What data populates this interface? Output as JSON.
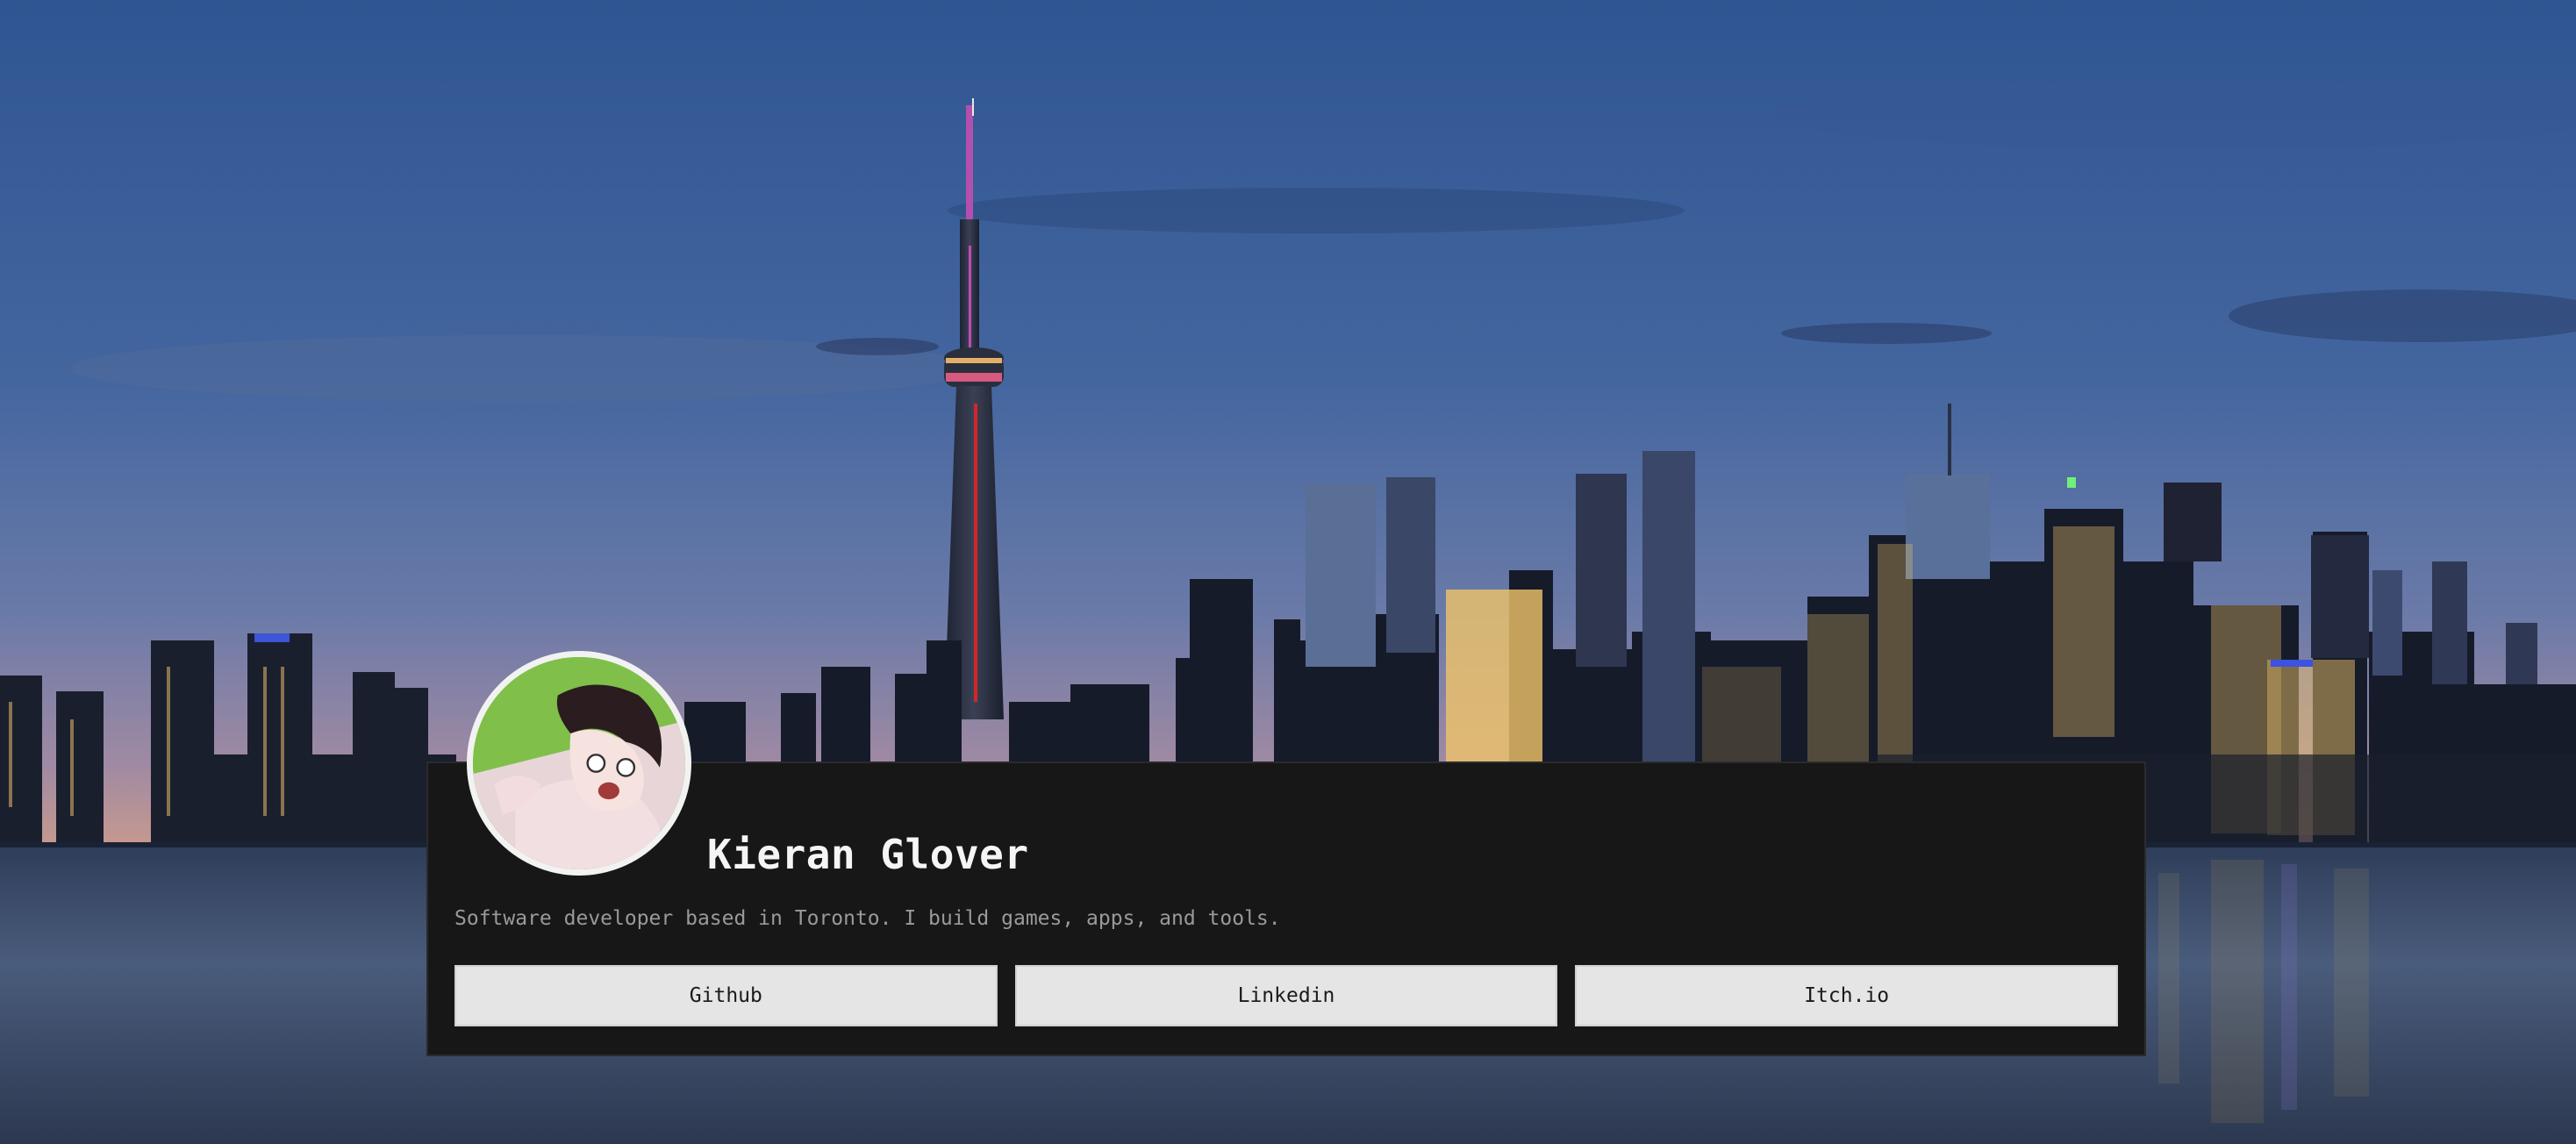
{
  "profile": {
    "name": "Kieran Glover",
    "bio": "Software developer based in Toronto. I build games, apps, and tools."
  },
  "links": [
    {
      "label": "Github"
    },
    {
      "label": "Linkedin"
    },
    {
      "label": "Itch.io"
    }
  ],
  "background": {
    "icon": "toronto-skyline-background",
    "sky_top": "#3b5f9e",
    "sky_horizon": "#b98a9a",
    "water": "#3a4c6b"
  },
  "colors": {
    "card": "#171717",
    "button": "#e5e5e5",
    "name_text": "#f5f5f5",
    "bio_text": "#9a9a9a"
  }
}
